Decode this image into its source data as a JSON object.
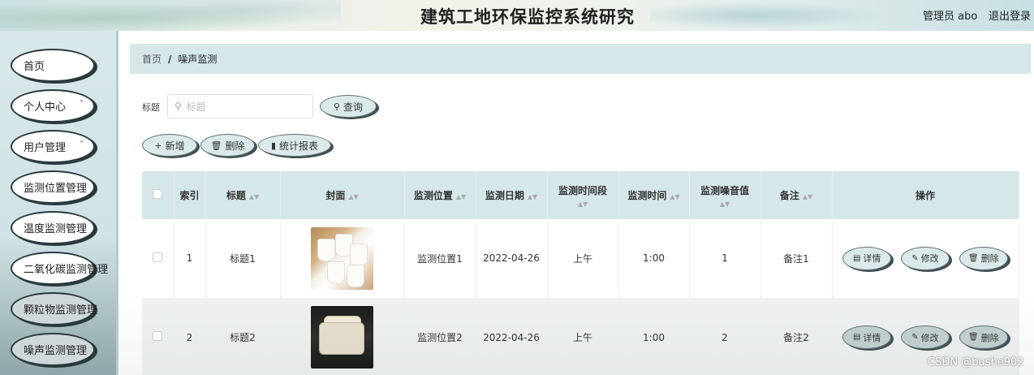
{
  "header": {
    "title": "建筑工地环保监控系统研究",
    "admin": "管理员 abo",
    "logout": "退出登录"
  },
  "sidebar": {
    "items": [
      {
        "label": "首页",
        "has_chevron": false
      },
      {
        "label": "个人中心",
        "has_chevron": true
      },
      {
        "label": "用户管理",
        "has_chevron": true
      },
      {
        "label": "监测位置管理",
        "has_chevron": false
      },
      {
        "label": "温度监测管理",
        "has_chevron": false
      },
      {
        "label": "二氧化碳监测管理",
        "has_chevron": false
      },
      {
        "label": "颗粒物监测管理",
        "has_chevron": false
      },
      {
        "label": "噪声监测管理",
        "has_chevron": false
      }
    ],
    "chevron": "˅"
  },
  "breadcrumb": {
    "home": "首页",
    "separator": "/",
    "current": "噪声监测"
  },
  "search": {
    "label": "标题",
    "placeholder": "标题",
    "button": "查询"
  },
  "toolbar": {
    "add": "新增",
    "delete": "删除",
    "report": "统计报表"
  },
  "table": {
    "columns": {
      "index": "索引",
      "title": "标题",
      "cover": "封面",
      "location": "监测位置",
      "date": "监测日期",
      "period": "监测时间段",
      "time": "监测时间",
      "noise": "监测噪音值",
      "remark": "备注",
      "actions": "操作"
    },
    "rows": [
      {
        "index": "1",
        "title": "标题1",
        "location": "监测位置1",
        "date": "2022-04-26",
        "period": "上午",
        "time": "1:00",
        "noise": "1",
        "remark": "备注1"
      },
      {
        "index": "2",
        "title": "标题2",
        "location": "监测位置2",
        "date": "2022-04-26",
        "period": "上午",
        "time": "1:00",
        "noise": "2",
        "remark": "备注2"
      }
    ],
    "row_actions": {
      "detail": "详情",
      "edit": "修改",
      "delete": "删除"
    }
  },
  "watermark": "CSDN @bushe902"
}
